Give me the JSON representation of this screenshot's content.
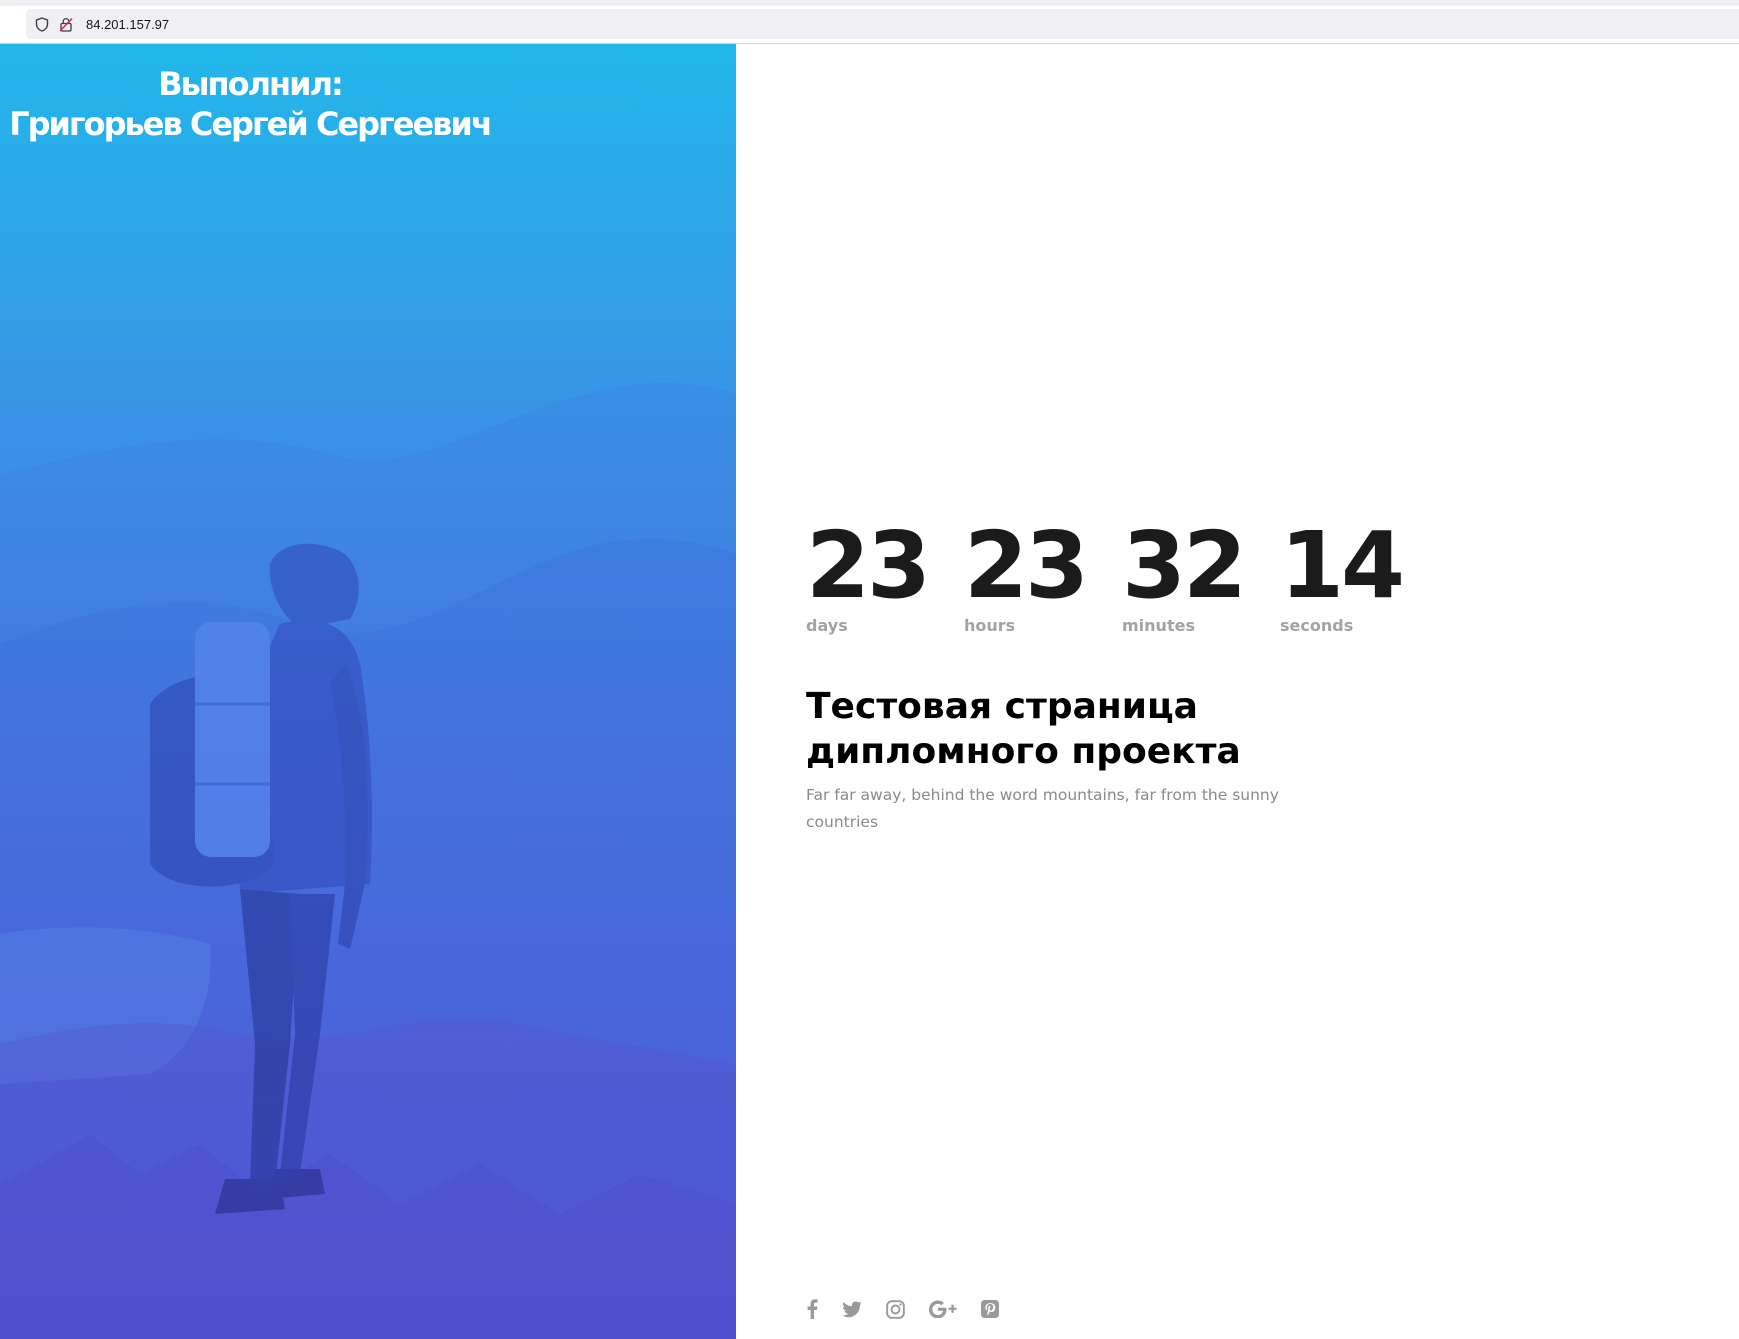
{
  "browser": {
    "url": "84.201.157.97",
    "icons": [
      "shield-icon",
      "insecure-lock-icon"
    ]
  },
  "hero": {
    "credit_line1": "Выполнил:",
    "credit_line2": "Григорьев Сергей Сергеевич",
    "gradient_top": "#22b7ea",
    "gradient_bottom": "#5a4fd6"
  },
  "countdown": {
    "days": "23",
    "days_label": "days",
    "hours": "23",
    "hours_label": "hours",
    "minutes": "32",
    "minutes_label": "minutes",
    "seconds": "14",
    "seconds_label": "seconds"
  },
  "main": {
    "title": "Тестовая страница дипломного проекта",
    "subtitle": "Far far away, behind the word mountains, far from the sunny countries"
  },
  "social": {
    "icons": [
      "facebook-icon",
      "twitter-icon",
      "instagram-icon",
      "google-plus-icon",
      "pinterest-icon"
    ],
    "icon_color": "#9a9a9a"
  }
}
